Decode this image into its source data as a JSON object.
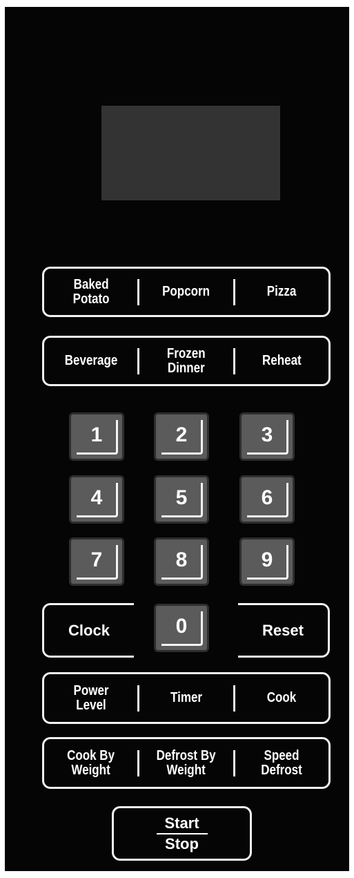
{
  "display": {
    "text": ""
  },
  "presets_row1": [
    {
      "label": "Baked\nPotato"
    },
    {
      "label": "Popcorn"
    },
    {
      "label": "Pizza"
    }
  ],
  "presets_row2": [
    {
      "label": "Beverage"
    },
    {
      "label": "Frozen\nDinner"
    },
    {
      "label": "Reheat"
    }
  ],
  "keypad": [
    "1",
    "2",
    "3",
    "4",
    "5",
    "6",
    "7",
    "8",
    "9",
    "0"
  ],
  "side_buttons": {
    "clock": "Clock",
    "reset": "Reset"
  },
  "function_row1": [
    {
      "label": "Power\nLevel"
    },
    {
      "label": "Timer"
    },
    {
      "label": "Cook"
    }
  ],
  "function_row2": [
    {
      "label": "Cook By\nWeight"
    },
    {
      "label": "Defrost By\nWeight"
    },
    {
      "label": "Speed\nDefrost"
    }
  ],
  "start_stop": {
    "start": "Start",
    "stop": "Stop"
  },
  "colors": {
    "panel": "#050505",
    "display": "#333333",
    "key": "#5b5b5b",
    "text": "#ffffff"
  }
}
